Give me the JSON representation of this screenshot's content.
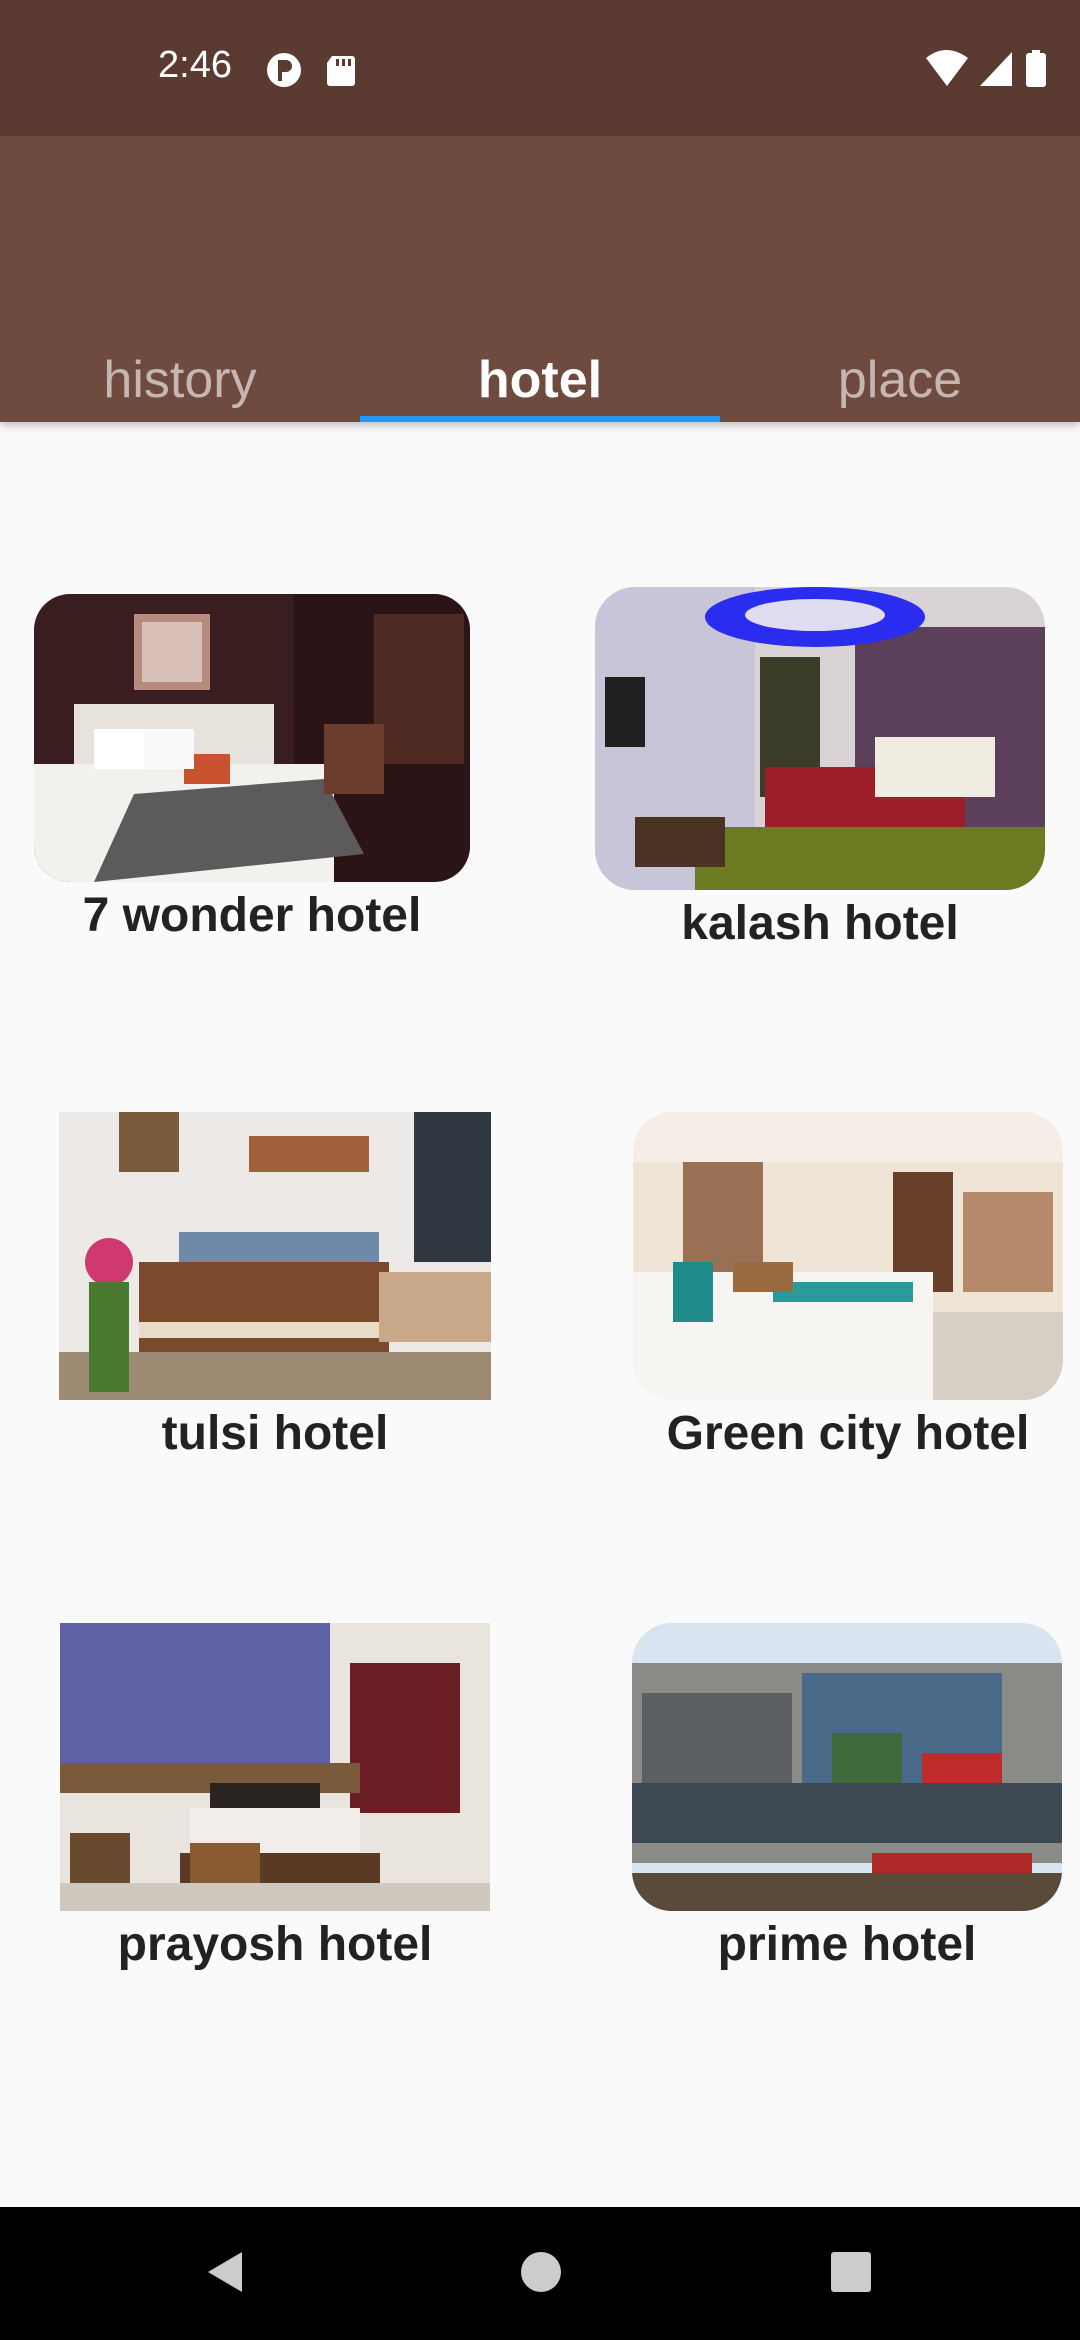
{
  "status_bar": {
    "time": "2:46",
    "left_icons": [
      "vpn-key-icon",
      "sd-card-icon"
    ],
    "right_icons": [
      "wifi-icon",
      "cell-signal-icon",
      "battery-icon"
    ]
  },
  "tabs": [
    {
      "label": "history",
      "active": false
    },
    {
      "label": "hotel",
      "active": true
    },
    {
      "label": "place",
      "active": false
    }
  ],
  "colors": {
    "status_bar": "#5b3b31",
    "app_bar": "#6f4a3f",
    "tab_indicator": "#2196f3",
    "background": "#fafafa"
  },
  "hotels": [
    {
      "name": "7 wonder hotel"
    },
    {
      "name": "kalash hotel"
    },
    {
      "name": "tulsi hotel"
    },
    {
      "name": "Green city hotel"
    },
    {
      "name": "prayosh hotel"
    },
    {
      "name": "prime hotel"
    }
  ],
  "nav_bar": {
    "buttons": [
      "back-icon",
      "home-icon",
      "recents-icon"
    ]
  }
}
